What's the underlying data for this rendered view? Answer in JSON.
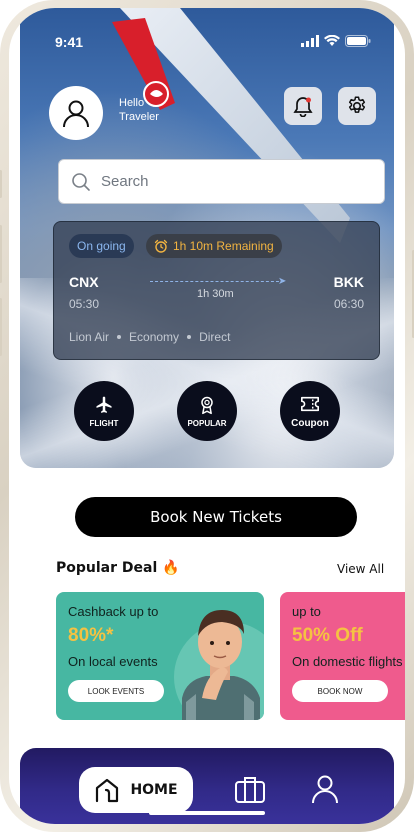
{
  "status": {
    "time": "9:41"
  },
  "header": {
    "greeting_line1": "Hello",
    "greeting_line2": "Traveler"
  },
  "search": {
    "placeholder": "Search"
  },
  "flight": {
    "status_label": "On going",
    "remaining_label": "1h 10m Remaining",
    "from_code": "CNX",
    "from_time": "05:30",
    "to_code": "BKK",
    "to_time": "06:30",
    "duration": "1h 30m",
    "airline": "Lion Air",
    "cabin": "Economy",
    "route_type": "Direct"
  },
  "categories": [
    {
      "label": "FLIGHT",
      "icon": "airplane-icon"
    },
    {
      "label": "POPULAR",
      "icon": "award-icon"
    },
    {
      "label": "Coupon",
      "icon": "ticket-icon"
    }
  ],
  "book_button": "Book New Tickets",
  "popular": {
    "title": "Popular Deal 🔥",
    "view_all": "View All",
    "deals": [
      {
        "line1": "Cashback up to",
        "value": "80%*",
        "line2": "On local events",
        "cta": "LOOK EVENTS",
        "color": "#47b7a2"
      },
      {
        "line1": "up to",
        "value": "50% Off",
        "line2": "On domestic flights",
        "cta": "BOOK NOW",
        "color": "#ef5b8d"
      }
    ]
  },
  "nav": {
    "home_label": "HOME",
    "items": [
      "home-icon",
      "briefcase-icon",
      "profile-icon"
    ]
  },
  "colors": {
    "nav_bg": "#2c2580",
    "accent_yellow": "#f5c242",
    "card_green": "#47b7a2",
    "card_pink": "#ef5b8d"
  }
}
